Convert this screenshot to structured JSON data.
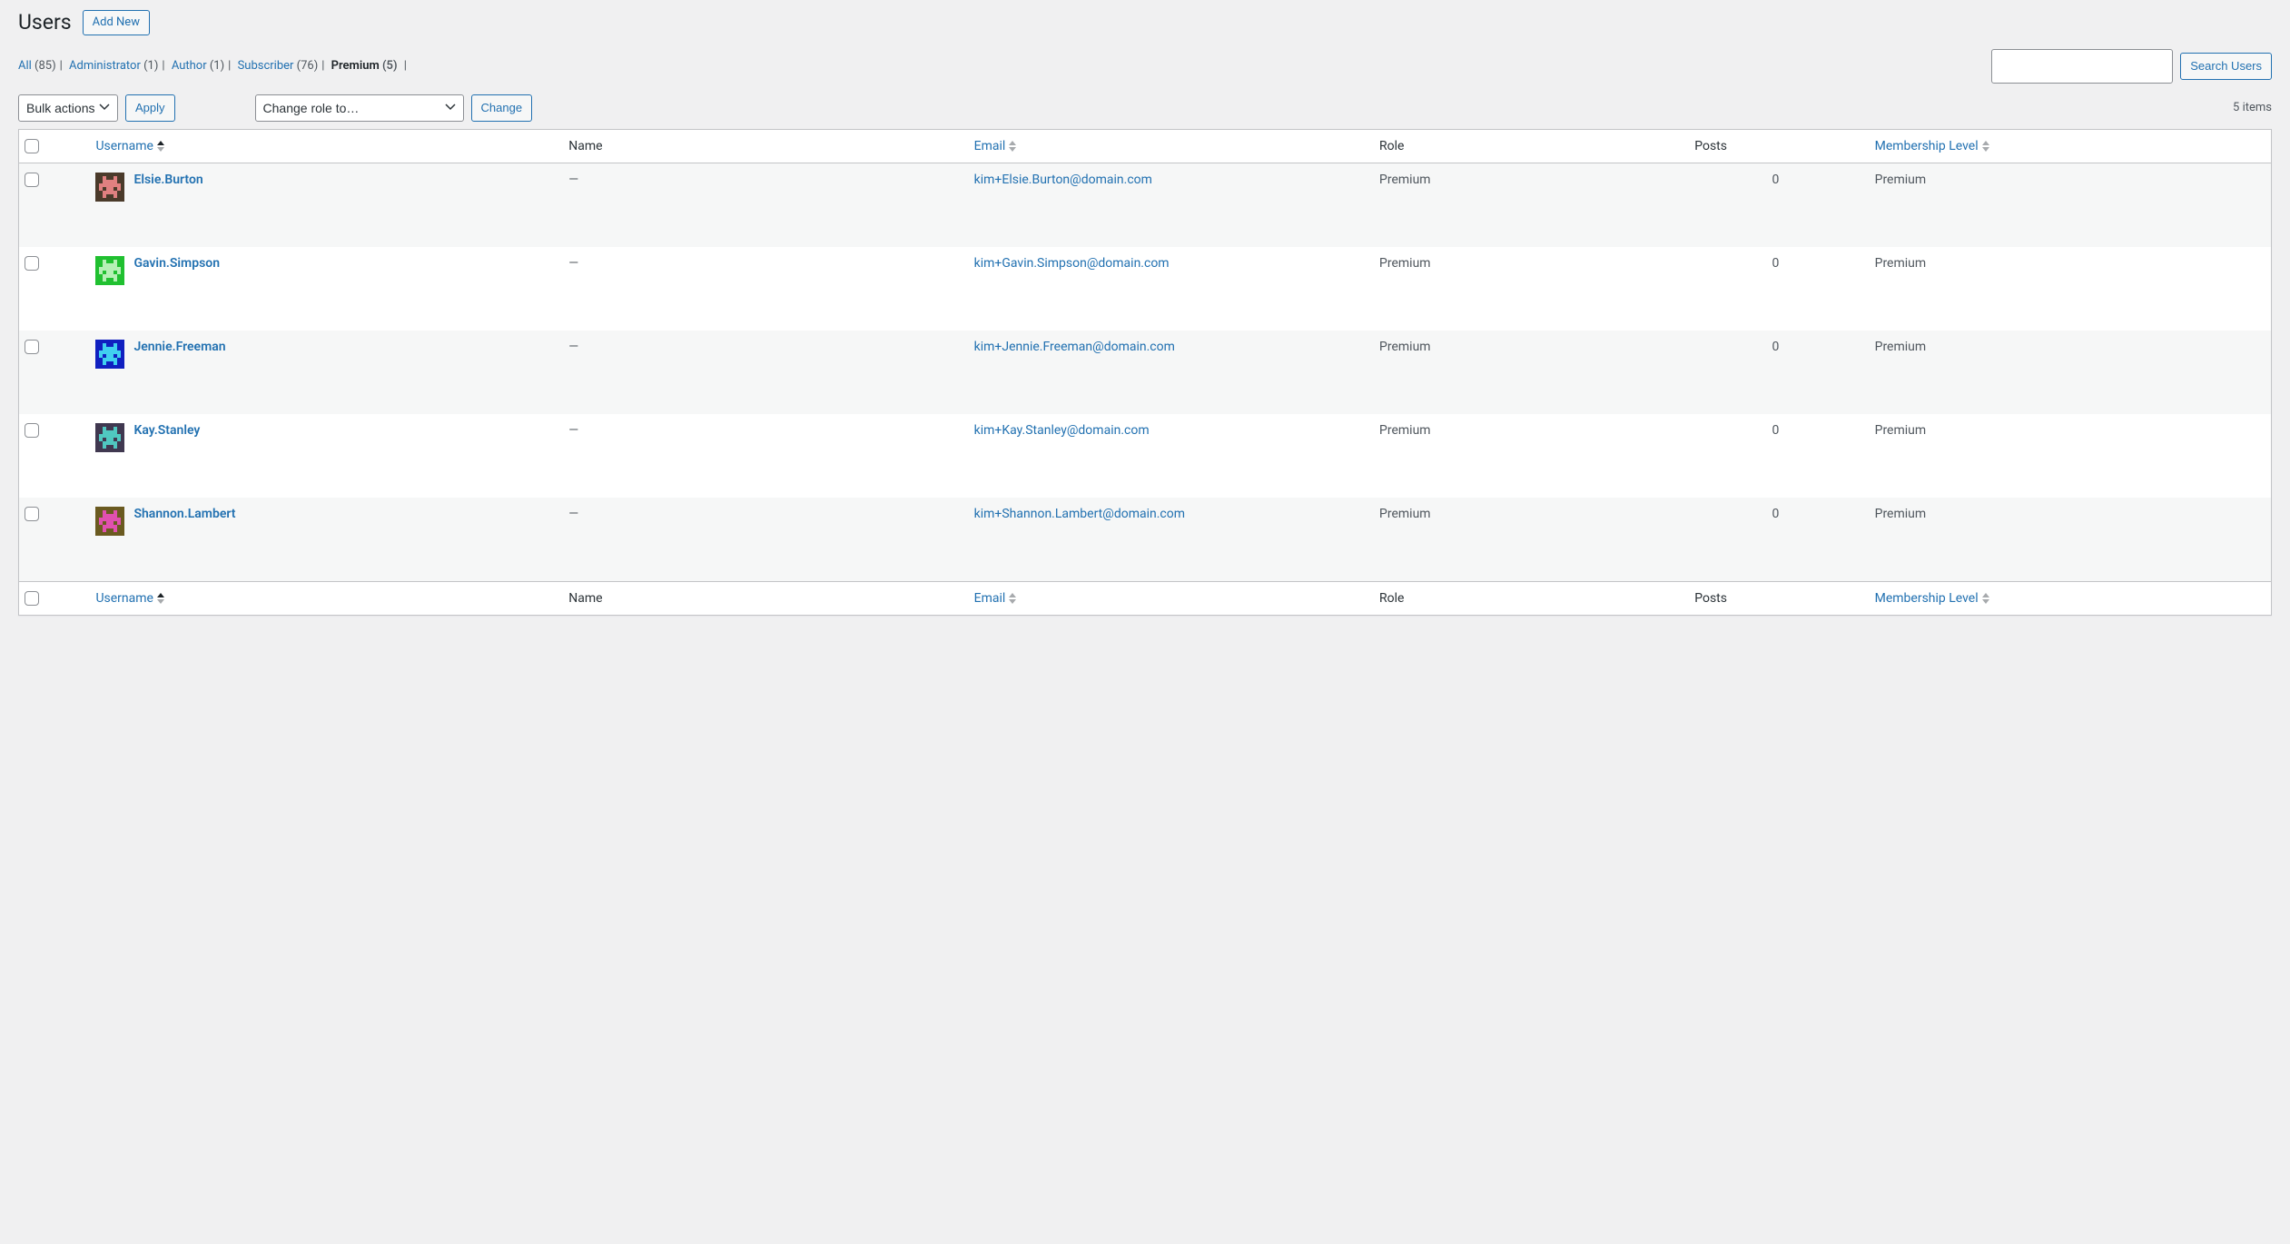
{
  "page": {
    "title": "Users",
    "add_new": "Add New"
  },
  "filters": [
    {
      "label": "All",
      "count": "(85)",
      "current": false
    },
    {
      "label": "Administrator",
      "count": "(1)",
      "current": false
    },
    {
      "label": "Author",
      "count": "(1)",
      "current": false
    },
    {
      "label": "Subscriber",
      "count": "(76)",
      "current": false
    },
    {
      "label": "Premium",
      "count": "(5)",
      "current": true
    }
  ],
  "search": {
    "button": "Search Users"
  },
  "bulk": {
    "bulk_actions": "Bulk actions",
    "apply": "Apply",
    "change_role": "Change role to…",
    "change": "Change"
  },
  "pagination": {
    "count_text": "5 items"
  },
  "columns": {
    "username": "Username",
    "name": "Name",
    "email": "Email",
    "role": "Role",
    "posts": "Posts",
    "membership": "Membership Level"
  },
  "users": [
    {
      "username": "Elsie.Burton",
      "name": "—",
      "email": "kim+Elsie.Burton@domain.com",
      "role": "Premium",
      "posts": "0",
      "membership": "Premium",
      "avatar": {
        "bg": "#4a3a2a",
        "fg": "#e08080"
      }
    },
    {
      "username": "Gavin.Simpson",
      "name": "—",
      "email": "kim+Gavin.Simpson@domain.com",
      "role": "Premium",
      "posts": "0",
      "membership": "Premium",
      "avatar": {
        "bg": "#20c030",
        "fg": "#b6f0b6"
      }
    },
    {
      "username": "Jennie.Freeman",
      "name": "—",
      "email": "kim+Jennie.Freeman@domain.com",
      "role": "Premium",
      "posts": "0",
      "membership": "Premium",
      "avatar": {
        "bg": "#1020c0",
        "fg": "#40d0f0"
      }
    },
    {
      "username": "Kay.Stanley",
      "name": "—",
      "email": "kim+Kay.Stanley@domain.com",
      "role": "Premium",
      "posts": "0",
      "membership": "Premium",
      "avatar": {
        "bg": "#403850",
        "fg": "#50c8c0"
      }
    },
    {
      "username": "Shannon.Lambert",
      "name": "—",
      "email": "kim+Shannon.Lambert@domain.com",
      "role": "Premium",
      "posts": "0",
      "membership": "Premium",
      "avatar": {
        "bg": "#6a5a20",
        "fg": "#e050b0"
      }
    }
  ]
}
